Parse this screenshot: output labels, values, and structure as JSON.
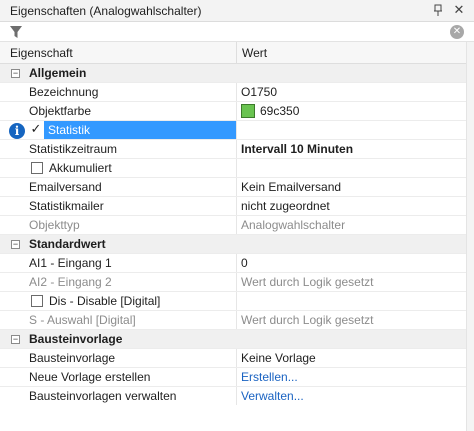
{
  "window": {
    "title": "Eigenschaften (Analogwahlschalter)",
    "pin_icon": "pin-icon",
    "close_icon": "close-icon"
  },
  "filter": {
    "icon": "funnel-icon",
    "value": "",
    "placeholder": "",
    "clear_icon": "clear-icon"
  },
  "header": {
    "property": "Eigenschaft",
    "value": "Wert"
  },
  "colors": {
    "selection": "#3399ff",
    "link": "#1a63c2",
    "swatch": "#69c350"
  },
  "categories": {
    "allgemein": "Allgemein",
    "standardwert": "Standardwert",
    "bausteinvorlage": "Bausteinvorlage"
  },
  "rows": {
    "bezeichnung": {
      "name": "Bezeichnung",
      "value": "O1750"
    },
    "objektfarbe": {
      "name": "Objektfarbe",
      "value": "69c350"
    },
    "statistik": {
      "name": "Statistik",
      "checked": true
    },
    "statistikzeitraum": {
      "name": "Statistikzeitraum",
      "value": "Intervall 10 Minuten"
    },
    "akkumuliert": {
      "name": "Akkumuliert",
      "checked": false
    },
    "emailversand": {
      "name": "Emailversand",
      "value": "Kein Emailversand"
    },
    "statistikmailer": {
      "name": "Statistikmailer",
      "value": "nicht zugeordnet"
    },
    "objekttyp": {
      "name": "Objekttyp",
      "value": "Analogwahlschalter"
    },
    "ai1": {
      "name": "AI1 - Eingang 1",
      "value": "0"
    },
    "ai2": {
      "name": "AI2 - Eingang 2",
      "value": "Wert durch Logik gesetzt"
    },
    "dis": {
      "name": "Dis - Disable [Digital]",
      "checked": false
    },
    "s_auswahl": {
      "name": "S - Auswahl [Digital]",
      "value": "Wert durch Logik gesetzt"
    },
    "bausteinvorlage": {
      "name": "Bausteinvorlage",
      "value": "Keine Vorlage"
    },
    "neue_vorlage": {
      "name": "Neue Vorlage erstellen",
      "value": "Erstellen..."
    },
    "vorlagen_verwalten": {
      "name": "Bausteinvorlagen verwalten",
      "value": "Verwalten..."
    }
  }
}
